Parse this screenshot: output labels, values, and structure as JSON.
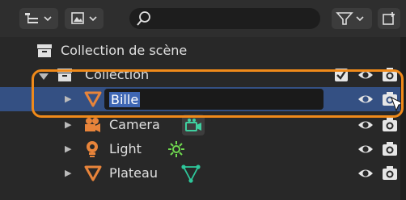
{
  "outliner": {
    "scene_collection_label": "Collection de scène",
    "items": [
      {
        "label": "Collection",
        "kind": "collection"
      },
      {
        "label": "Bille",
        "kind": "mesh",
        "editing": true
      },
      {
        "label": "Camera",
        "kind": "camera"
      },
      {
        "label": "Light",
        "kind": "light"
      },
      {
        "label": "Plateau",
        "kind": "mesh"
      }
    ]
  },
  "colors": {
    "background": "#282828",
    "selected_row": "#345083",
    "highlight_frame": "#f08a1a",
    "mesh_icon": "#e8843a",
    "camera_data_icon": "#3fcf9f",
    "light_data_icon": "#6fd94f",
    "mesh_data_icon": "#2ec79b"
  }
}
